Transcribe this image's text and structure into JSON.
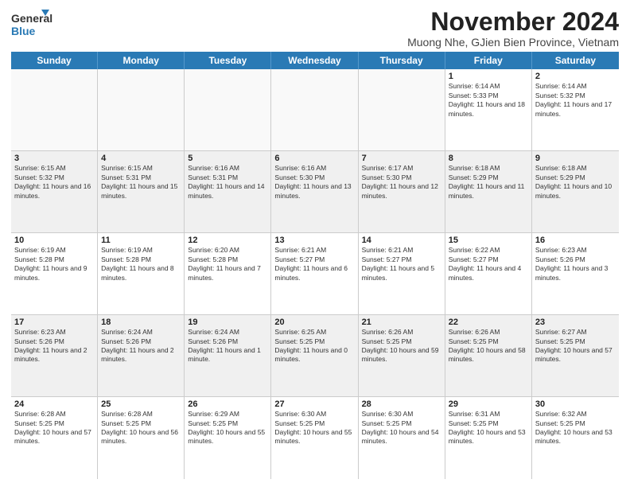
{
  "header": {
    "logo_general": "General",
    "logo_blue": "Blue",
    "month_title": "November 2024",
    "location": "Muong Nhe, GJien Bien Province, Vietnam"
  },
  "days_of_week": [
    "Sunday",
    "Monday",
    "Tuesday",
    "Wednesday",
    "Thursday",
    "Friday",
    "Saturday"
  ],
  "weeks": [
    [
      {
        "day": "",
        "info": ""
      },
      {
        "day": "",
        "info": ""
      },
      {
        "day": "",
        "info": ""
      },
      {
        "day": "",
        "info": ""
      },
      {
        "day": "",
        "info": ""
      },
      {
        "day": "1",
        "info": "Sunrise: 6:14 AM\nSunset: 5:33 PM\nDaylight: 11 hours and 18 minutes."
      },
      {
        "day": "2",
        "info": "Sunrise: 6:14 AM\nSunset: 5:32 PM\nDaylight: 11 hours and 17 minutes."
      }
    ],
    [
      {
        "day": "3",
        "info": "Sunrise: 6:15 AM\nSunset: 5:32 PM\nDaylight: 11 hours and 16 minutes."
      },
      {
        "day": "4",
        "info": "Sunrise: 6:15 AM\nSunset: 5:31 PM\nDaylight: 11 hours and 15 minutes."
      },
      {
        "day": "5",
        "info": "Sunrise: 6:16 AM\nSunset: 5:31 PM\nDaylight: 11 hours and 14 minutes."
      },
      {
        "day": "6",
        "info": "Sunrise: 6:16 AM\nSunset: 5:30 PM\nDaylight: 11 hours and 13 minutes."
      },
      {
        "day": "7",
        "info": "Sunrise: 6:17 AM\nSunset: 5:30 PM\nDaylight: 11 hours and 12 minutes."
      },
      {
        "day": "8",
        "info": "Sunrise: 6:18 AM\nSunset: 5:29 PM\nDaylight: 11 hours and 11 minutes."
      },
      {
        "day": "9",
        "info": "Sunrise: 6:18 AM\nSunset: 5:29 PM\nDaylight: 11 hours and 10 minutes."
      }
    ],
    [
      {
        "day": "10",
        "info": "Sunrise: 6:19 AM\nSunset: 5:28 PM\nDaylight: 11 hours and 9 minutes."
      },
      {
        "day": "11",
        "info": "Sunrise: 6:19 AM\nSunset: 5:28 PM\nDaylight: 11 hours and 8 minutes."
      },
      {
        "day": "12",
        "info": "Sunrise: 6:20 AM\nSunset: 5:28 PM\nDaylight: 11 hours and 7 minutes."
      },
      {
        "day": "13",
        "info": "Sunrise: 6:21 AM\nSunset: 5:27 PM\nDaylight: 11 hours and 6 minutes."
      },
      {
        "day": "14",
        "info": "Sunrise: 6:21 AM\nSunset: 5:27 PM\nDaylight: 11 hours and 5 minutes."
      },
      {
        "day": "15",
        "info": "Sunrise: 6:22 AM\nSunset: 5:27 PM\nDaylight: 11 hours and 4 minutes."
      },
      {
        "day": "16",
        "info": "Sunrise: 6:23 AM\nSunset: 5:26 PM\nDaylight: 11 hours and 3 minutes."
      }
    ],
    [
      {
        "day": "17",
        "info": "Sunrise: 6:23 AM\nSunset: 5:26 PM\nDaylight: 11 hours and 2 minutes."
      },
      {
        "day": "18",
        "info": "Sunrise: 6:24 AM\nSunset: 5:26 PM\nDaylight: 11 hours and 2 minutes."
      },
      {
        "day": "19",
        "info": "Sunrise: 6:24 AM\nSunset: 5:26 PM\nDaylight: 11 hours and 1 minute."
      },
      {
        "day": "20",
        "info": "Sunrise: 6:25 AM\nSunset: 5:25 PM\nDaylight: 11 hours and 0 minutes."
      },
      {
        "day": "21",
        "info": "Sunrise: 6:26 AM\nSunset: 5:25 PM\nDaylight: 10 hours and 59 minutes."
      },
      {
        "day": "22",
        "info": "Sunrise: 6:26 AM\nSunset: 5:25 PM\nDaylight: 10 hours and 58 minutes."
      },
      {
        "day": "23",
        "info": "Sunrise: 6:27 AM\nSunset: 5:25 PM\nDaylight: 10 hours and 57 minutes."
      }
    ],
    [
      {
        "day": "24",
        "info": "Sunrise: 6:28 AM\nSunset: 5:25 PM\nDaylight: 10 hours and 57 minutes."
      },
      {
        "day": "25",
        "info": "Sunrise: 6:28 AM\nSunset: 5:25 PM\nDaylight: 10 hours and 56 minutes."
      },
      {
        "day": "26",
        "info": "Sunrise: 6:29 AM\nSunset: 5:25 PM\nDaylight: 10 hours and 55 minutes."
      },
      {
        "day": "27",
        "info": "Sunrise: 6:30 AM\nSunset: 5:25 PM\nDaylight: 10 hours and 55 minutes."
      },
      {
        "day": "28",
        "info": "Sunrise: 6:30 AM\nSunset: 5:25 PM\nDaylight: 10 hours and 54 minutes."
      },
      {
        "day": "29",
        "info": "Sunrise: 6:31 AM\nSunset: 5:25 PM\nDaylight: 10 hours and 53 minutes."
      },
      {
        "day": "30",
        "info": "Sunrise: 6:32 AM\nSunset: 5:25 PM\nDaylight: 10 hours and 53 minutes."
      }
    ]
  ]
}
